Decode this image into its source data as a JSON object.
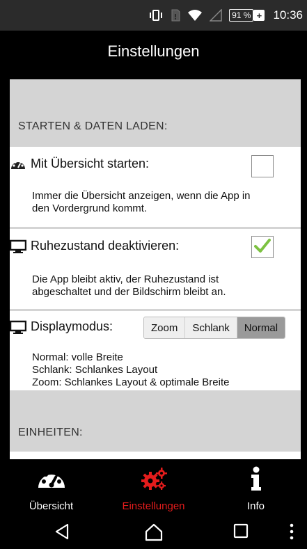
{
  "status_bar": {
    "battery_text": "91 %",
    "charge_symbol": "+",
    "time": "10:36",
    "icons": [
      "vibrate-icon",
      "sim-icon",
      "wifi-icon",
      "signal-icon",
      "battery-icon"
    ]
  },
  "title_bar": {
    "title": "Einstellungen"
  },
  "sections": {
    "start": {
      "header": "STARTEN & DATEN LADEN:",
      "overview": {
        "label": "Mit Übersicht starten:",
        "description_line1": "Immer die Übersicht anzeigen, wenn die App in",
        "description_line2": "den Vordergrund kommt.",
        "checked": false,
        "icon": "speedometer-icon"
      },
      "sleep": {
        "label": "Ruhezustand deaktivieren:",
        "description_line1": "Die App bleibt aktiv, der Ruhezustand ist",
        "description_line2": "abgeschaltet und der Bildschirm bleibt an.",
        "checked": true,
        "icon": "monitor-icon"
      },
      "display": {
        "label": "Displaymodus:",
        "options": [
          "Zoom",
          "Schlank",
          "Normal"
        ],
        "selected": "Normal",
        "description_line1": "Normal: volle Breite",
        "description_line2": "Schlank: Schlankes Layout",
        "description_line3": "Zoom: Schlankes Layout & optimale Breite",
        "icon": "monitor-icon"
      }
    },
    "units": {
      "header": "EINHEITEN:"
    }
  },
  "bottom_nav": {
    "items": [
      {
        "label": "Übersicht",
        "icon": "speedometer-icon"
      },
      {
        "label": "Einstellungen",
        "icon": "gears-icon",
        "active": true
      },
      {
        "label": "Info",
        "icon": "info-icon"
      }
    ]
  },
  "colors": {
    "accent_active": "#e41c1c",
    "check_green": "#7dc242",
    "section_bg": "#d4d4d4",
    "segment_selected": "#9a9a9a"
  }
}
